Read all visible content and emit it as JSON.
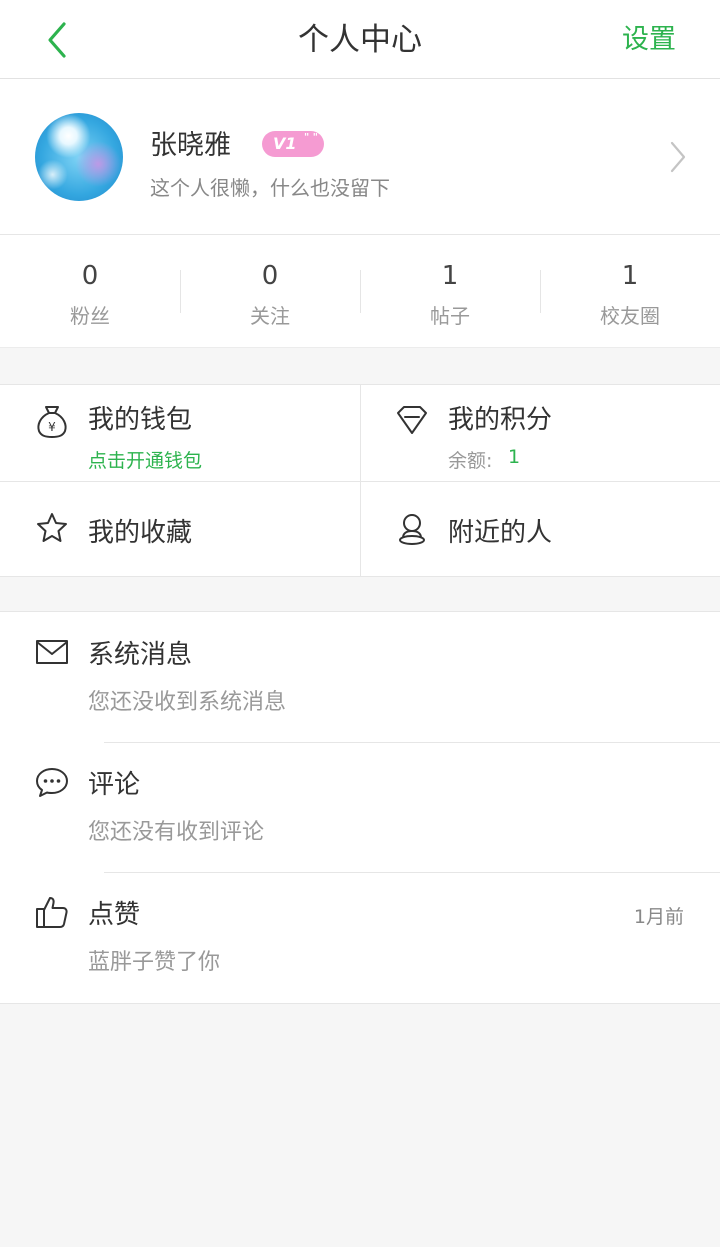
{
  "nav": {
    "title": "个人中心",
    "settings_label": "设置"
  },
  "profile": {
    "name": "张晓雅",
    "level": "V1",
    "signature": "这个人很懒，什么也没留下"
  },
  "stats": [
    {
      "value": "0",
      "label": "粉丝"
    },
    {
      "value": "0",
      "label": "关注"
    },
    {
      "value": "1",
      "label": "帖子"
    },
    {
      "value": "1",
      "label": "校友圈"
    }
  ],
  "grid": {
    "wallet": {
      "title": "我的钱包",
      "subtitle": "点击开通钱包"
    },
    "points": {
      "title": "我的积分",
      "balance_label": "余额:",
      "balance_value": "1"
    },
    "favorites": {
      "title": "我的收藏"
    },
    "nearby": {
      "title": "附近的人"
    }
  },
  "messages": [
    {
      "title": "系统消息",
      "subtitle": "您还没收到系统消息",
      "time": ""
    },
    {
      "title": "评论",
      "subtitle": "您还没有收到评论",
      "time": ""
    },
    {
      "title": "点赞",
      "subtitle": "蓝胖子赞了你",
      "time": "1月前"
    }
  ],
  "colors": {
    "accent": "#2db34e",
    "badge": "#f59bd2",
    "background": "#f6f6f6"
  },
  "icons": {
    "back": "chevron-left-icon",
    "arrow": "chevron-right-icon",
    "wallet": "money-bag-icon",
    "points": "gem-icon",
    "favorites": "star-icon",
    "nearby": "person-pin-icon",
    "system": "envelope-icon",
    "comment": "chat-bubble-icon",
    "like": "thumbs-up-icon"
  }
}
